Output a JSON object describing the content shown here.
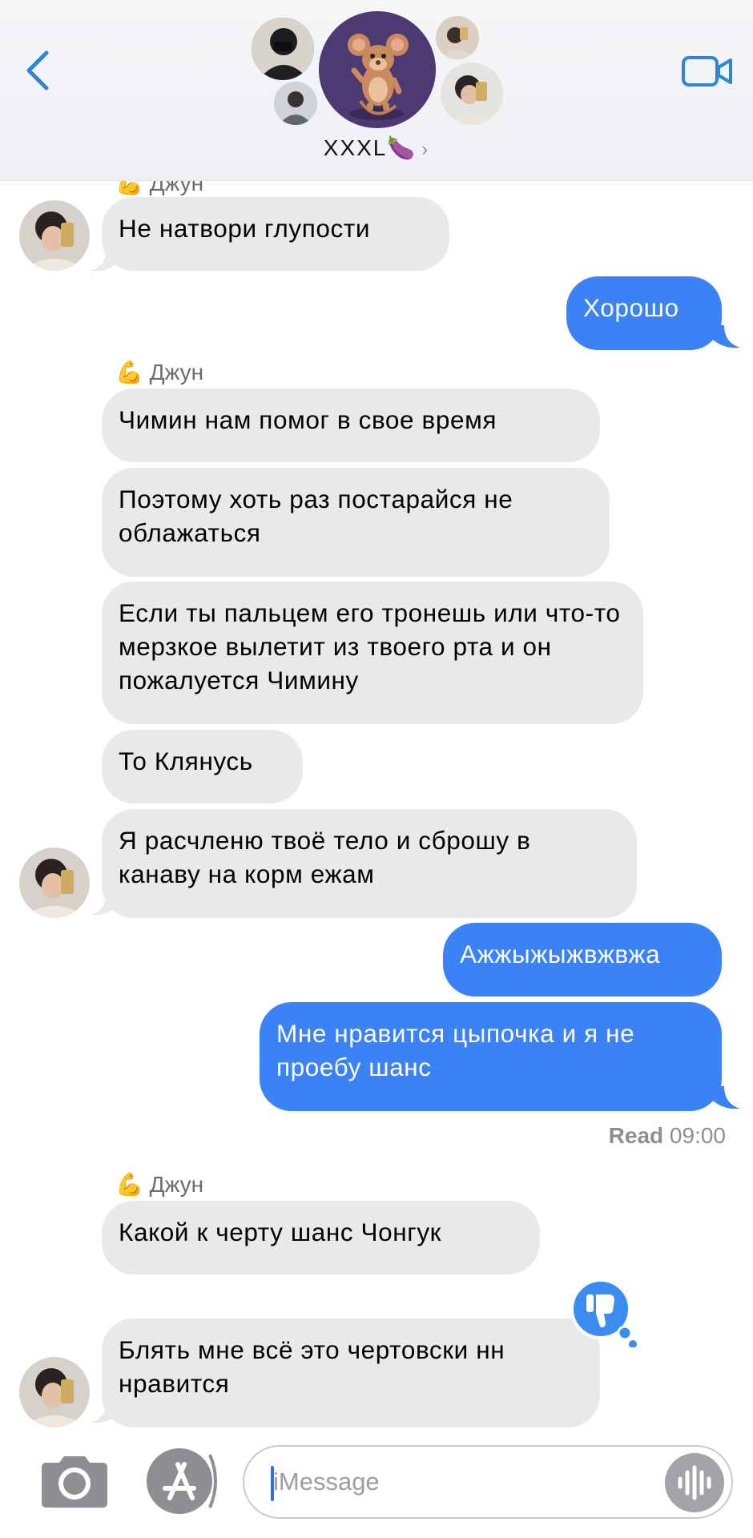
{
  "header": {
    "title": "XXXL🍆",
    "chevron": "›",
    "back_icon": "chevron-left-icon",
    "video_icon": "video-camera-icon",
    "accent": "#2f86d6"
  },
  "messages": [
    {
      "sender": "💪 Джун",
      "text": "Не натвори глупости"
    },
    {
      "text": "Хорошо"
    },
    {
      "sender": "💪 Джун",
      "text": "Чимин нам помог в свое время"
    },
    {
      "text": "Поэтому хоть раз постарайся не облажаться"
    },
    {
      "text": "Если ты пальцем его тронешь  или что-то мерзкое вылетит из твоего рта и он пожалуется Чимину"
    },
    {
      "text": "То Клянусь"
    },
    {
      "text": "Я расчленю твоё тело  и сброшу в канаву на корм ежам"
    },
    {
      "text": "Ажжыжыжвжвжа"
    },
    {
      "text": "Мне нравится цыпочка и я не проебу шанс"
    },
    {
      "sender": "💪 Джун",
      "text": "Какой к черту шанс Чонгук"
    },
    {
      "text": "Блять мне всё это чертовски нн нравится",
      "reaction": "thumbs-down-icon"
    }
  ],
  "read_receipt": {
    "label": "Read",
    "time": "09:00"
  },
  "input_bar": {
    "placeholder": "iMessage",
    "camera_icon": "camera-icon",
    "apps_icon": "app-store-icon",
    "audio_icon": "audio-waveform-icon"
  },
  "colors": {
    "outgoing_bubble": "#3a82f6",
    "incoming_bubble": "#e9e9eb",
    "reaction_bg": "#3a8cf0"
  }
}
